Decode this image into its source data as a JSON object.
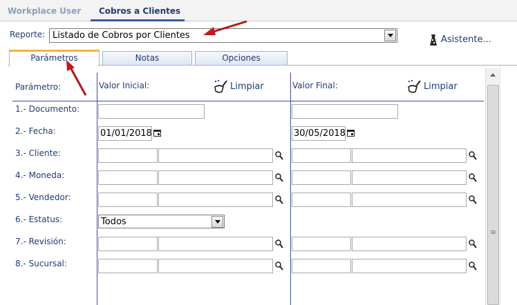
{
  "top_tabs": [
    {
      "label": "Workplace User"
    },
    {
      "label": "Cobros a Clientes"
    }
  ],
  "reporte": {
    "label": "Reporte:",
    "value": "Listado de Cobros por Clientes"
  },
  "asistente": {
    "label": "Asistente..."
  },
  "sub_tabs": [
    {
      "label": "Parámetros"
    },
    {
      "label": "Notas"
    },
    {
      "label": "Opciones"
    }
  ],
  "headers": {
    "parametro": "Parámetro:",
    "valor_inicial": "Valor Inicial:",
    "valor_final": "Valor Final:",
    "limpiar": "Limpiar"
  },
  "params": [
    {
      "label": "1.- Documento:"
    },
    {
      "label": "2.- Fecha:",
      "initial": "01/01/2018",
      "final": "30/05/2018"
    },
    {
      "label": "3.- Cliente:"
    },
    {
      "label": "4.- Moneda:"
    },
    {
      "label": "5.- Vendedor:"
    },
    {
      "label": "6.- Estatus:",
      "initial": "Todos"
    },
    {
      "label": "7.- Revisión:"
    },
    {
      "label": "8.- Sucursal:"
    }
  ],
  "colors": {
    "accent": "#3b4e9b",
    "active_tab_top": "#f0b43c",
    "annotation_arrow": "#c0191e"
  },
  "icons": [
    "report-wizard-icon",
    "broom-icon",
    "calendar-icon",
    "search-icon",
    "dropdown-arrow-icon"
  ]
}
